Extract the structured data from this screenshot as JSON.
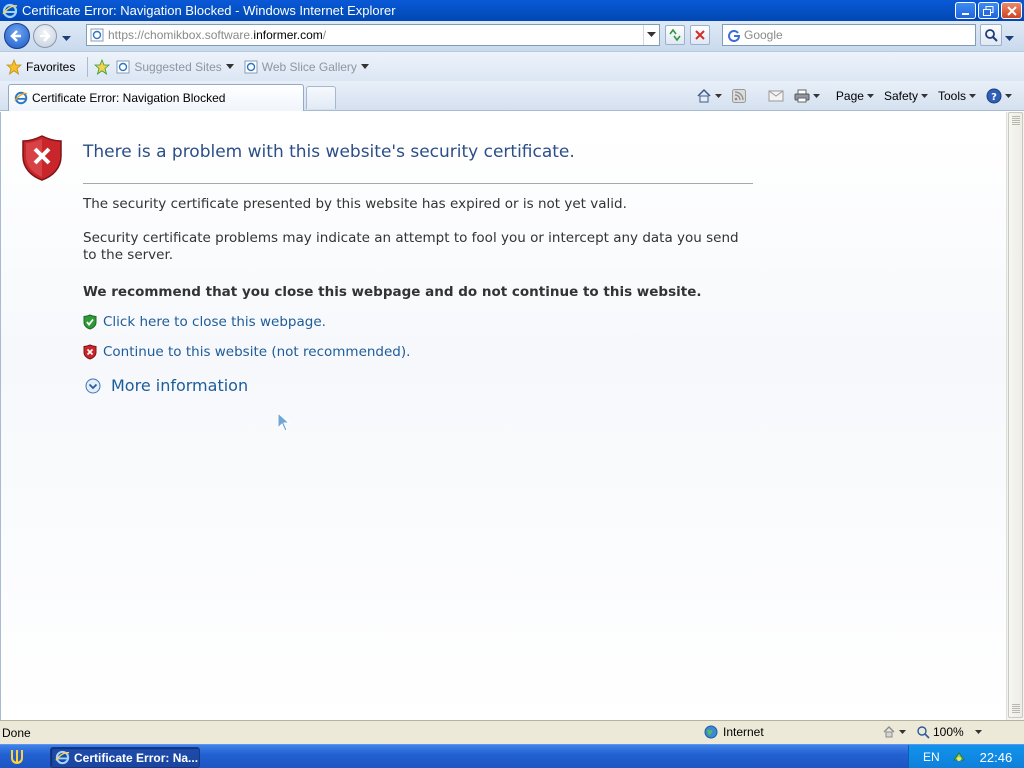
{
  "window": {
    "title": "Certificate Error: Navigation Blocked - Windows Internet Explorer"
  },
  "address_bar": {
    "url_prefix": "https://chomikbox.software.",
    "url_domain": "informer.com",
    "url_suffix": "/",
    "search_placeholder": "Google"
  },
  "favorites_bar": {
    "favorites_label": "Favorites",
    "items": [
      {
        "label": "Suggested Sites",
        "icon": "ie-page-icon"
      },
      {
        "label": "Web Slice Gallery",
        "icon": "ie-page-icon"
      }
    ]
  },
  "tabs": {
    "active_label": "Certificate Error: Navigation Blocked"
  },
  "command_bar": {
    "page_label": "Page",
    "safety_label": "Safety",
    "tools_label": "Tools"
  },
  "error_page": {
    "title": "There is a problem with this website's security certificate.",
    "paragraph1": "The security certificate presented by this website has expired or is not yet valid.",
    "paragraph2": "Security certificate problems may indicate an attempt to fool you or intercept any data you send to the server.",
    "recommendation": "We recommend that you close this webpage and do not continue to this website.",
    "close_link": "Click here to close this webpage.",
    "continue_link": "Continue to this website (not recommended).",
    "more_info": "More information"
  },
  "status_bar": {
    "status": "Done",
    "zone": "Internet",
    "zoom": "100%"
  },
  "taskbar": {
    "task_label": "Certificate Error: Na...",
    "language": "EN",
    "clock": "22:46"
  },
  "colors": {
    "title_text": "#2c4e88",
    "link": "#1d5c9a",
    "titlebar": "#0553c7",
    "shield_red": "#c8262b",
    "shield_green": "#2f9a3a"
  }
}
